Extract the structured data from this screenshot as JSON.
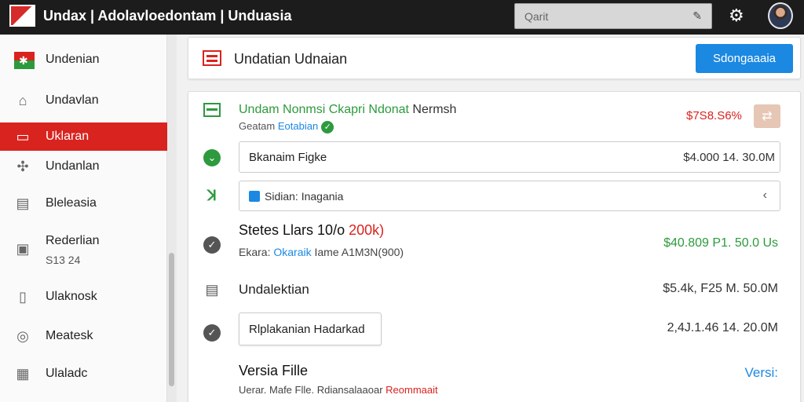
{
  "topbar": {
    "title": "Undax | Adolavloedontam | Unduasia",
    "search_placeholder": "Qarit"
  },
  "sidebar": {
    "items": [
      {
        "label": "Undenian",
        "icon": "flag-icon"
      },
      {
        "label": "Undavlan",
        "icon": "home-icon"
      },
      {
        "label": "Uklaran",
        "icon": "folder-icon"
      },
      {
        "label": "Undanlan",
        "icon": "analytics-icon"
      },
      {
        "label": "Bleleasia",
        "icon": "document-icon"
      },
      {
        "label": "Rederlian",
        "sub": "S13 24",
        "icon": "clipboard-icon"
      },
      {
        "label": "Ulaknosk",
        "icon": "file-icon"
      },
      {
        "label": "Meatesk",
        "icon": "check-circle-icon"
      },
      {
        "label": "Ulaladc",
        "icon": "package-icon"
      }
    ]
  },
  "header": {
    "title": "Undatian Udnaian",
    "button_label": "Sdongaaaia"
  },
  "main": {
    "row1": {
      "title_green": "Undam Nonmsi Ckapri  Ndonat",
      "title_rest": " Nermsh",
      "sub_prefix": "Geatam ",
      "sub_link": "Eotabian",
      "amount": "$7S8.S6%"
    },
    "row2": {
      "field_label": "Bkanaim Figke",
      "value": "$4.000 14. 30.0M"
    },
    "row3": {
      "select_label": "Sidian: Inagania"
    },
    "row4": {
      "title_a": "Stetes Llars 10/o ",
      "title_b": "200k)",
      "sub_prefix": "Ekara: ",
      "sub_link": "Okaraik",
      "sub_rest": " Iame A1M3N(900)",
      "amount": "$40.809 P1. 50.0 Us"
    },
    "row5": {
      "label": "Undalektian",
      "value": "$5.4k, F25 M. 50.0M"
    },
    "row6": {
      "button_label": "Rlplakanian Hadarkad",
      "value": "2,4J.1.46 14. 20.0M"
    },
    "row7": {
      "title": "Versia Fille",
      "sub_a": "Uerar. Mafe Flle. Rdiansalaaoar ",
      "sub_b": "Reommaait",
      "link": "Versi:"
    }
  },
  "colors": {
    "accent_red": "#d9231f",
    "primary_blue": "#1b88e2",
    "success_green": "#2d9a3d"
  }
}
